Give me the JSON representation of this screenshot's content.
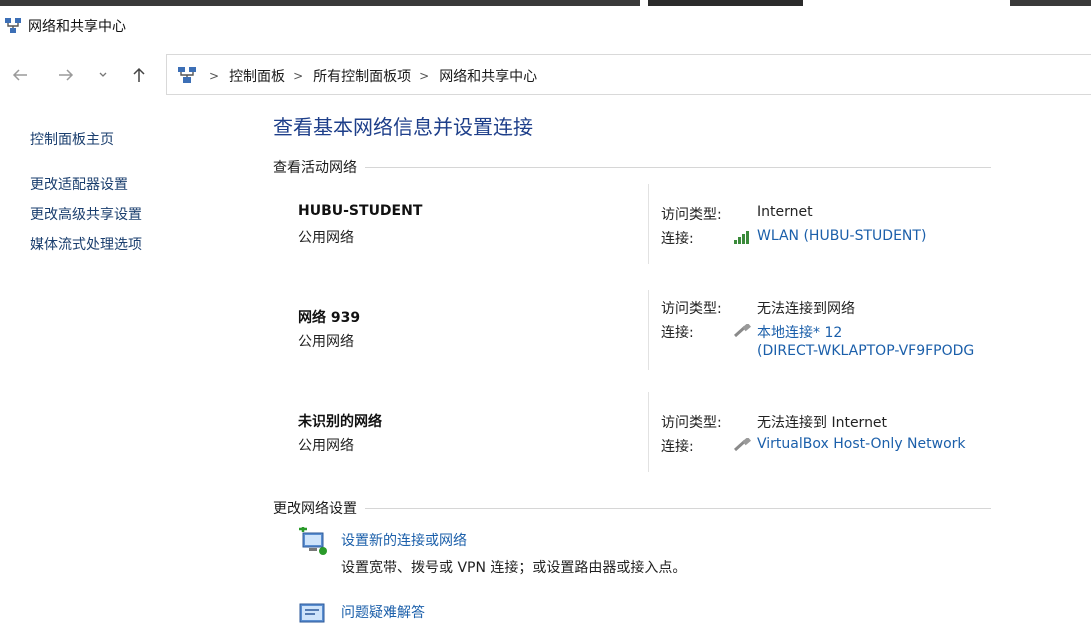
{
  "window": {
    "title": "网络和共享中心"
  },
  "breadcrumbs": [
    "控制面板",
    "所有控制面板项",
    "网络和共享中心"
  ],
  "sidebar": {
    "items": [
      {
        "label": "控制面板主页"
      },
      {
        "label": "更改适配器设置"
      },
      {
        "label": "更改高级共享设置"
      },
      {
        "label": "媒体流式处理选项"
      }
    ]
  },
  "main": {
    "title": "查看基本网络信息并设置连接",
    "active_section": "查看活动网络",
    "change_section": "更改网络设置",
    "access_label": "访问类型:",
    "conn_label": "连接:",
    "networks": [
      {
        "name": "HUBU-STUDENT",
        "category": "公用网络",
        "access": "Internet",
        "connection": "WLAN (HUBU-STUDENT)",
        "connection_line2": "",
        "icon": "wifi-signal-icon"
      },
      {
        "name": "网络 939",
        "category": "公用网络",
        "access": "无法连接到网络",
        "connection": "本地连接* 12",
        "connection_line2": "(DIRECT-WKLAPTOP-VF9FPODG",
        "icon": "ethernet-cable-icon"
      },
      {
        "name": "未识别的网络",
        "category": "公用网络",
        "access": "无法连接到 Internet",
        "connection": "VirtualBox Host-Only Network",
        "connection_line2": "",
        "icon": "ethernet-cable-icon"
      }
    ],
    "tasks": [
      {
        "label": "设置新的连接或网络",
        "desc": "设置宽带、拨号或 VPN 连接；或设置路由器或接入点。"
      },
      {
        "label": "问题疑难解答",
        "desc": ""
      }
    ]
  }
}
